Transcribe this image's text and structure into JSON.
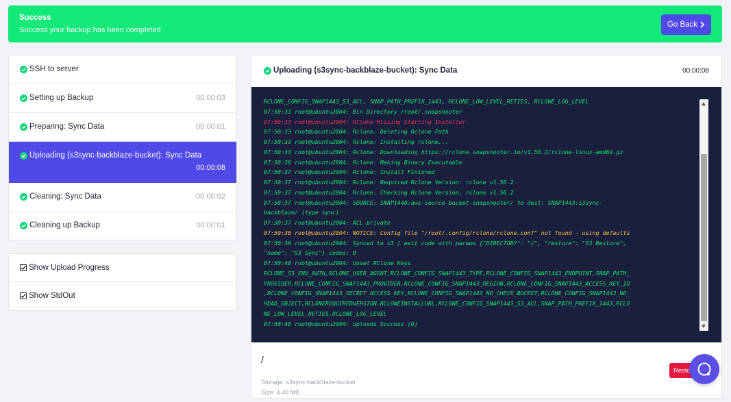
{
  "banner": {
    "title": "Success",
    "message": "Success your backup has been completed",
    "go_back_label": "Go Back"
  },
  "steps": [
    {
      "label": "SSH to server",
      "time": ""
    },
    {
      "label": "Setting up Backup",
      "time": "00:00:03"
    },
    {
      "label": "Preparing: Sync Data",
      "time": "00:00:01"
    },
    {
      "label": "Uploading (s3sync-backblaze-bucket): Sync Data",
      "time": "00:00:08",
      "active": true
    },
    {
      "label": "Cleaning: Sync Data",
      "time": "00:00:02"
    },
    {
      "label": "Cleaning up Backup",
      "time": "00:00:01"
    }
  ],
  "options": [
    {
      "label": "Show Upload Progress",
      "checked": true
    },
    {
      "label": "Show StdOut",
      "checked": true
    }
  ],
  "panel": {
    "title": "Uploading (s3sync-backblaze-bucket): Sync Data",
    "time": "00:00:08"
  },
  "log_lines": [
    {
      "text": "RCLONE_CONFIG_SNAP1443_S3_ACL, SNAP_PATH_PREFIX_1443, RCLONE_LOW_LEVEL_RETIES, RCLONE_LOG_LEVEL",
      "type": "ok"
    },
    {
      "text": "07:50:33 root@ubuntu2004: Bin Directory /root/.snapshooter",
      "type": "ok"
    },
    {
      "text": "07:50:33 root@ubuntu2004: RClone Missing Starting Installer",
      "type": "err"
    },
    {
      "text": "07:50:33 root@ubuntu2004: Rclone: Deleting Rclone Path",
      "type": "ok"
    },
    {
      "text": "07:50:33 root@ubuntu2004: Rclone: Installing rclone...",
      "type": "ok"
    },
    {
      "text": "07:50:33 root@ubuntu2004: Rclone: Downloading https://rclone.snapshooter.io/v1.56.2/rclone-linux-amd64.gz",
      "type": "ok"
    },
    {
      "text": "07:50:36 root@ubuntu2004: Rclone: Making Binary Executable",
      "type": "ok"
    },
    {
      "text": "07:50:37 root@ubuntu2004: Rclone: Install Finished",
      "type": "ok"
    },
    {
      "text": "07:50:37 root@ubuntu2004: Rclone: Required Rclone Version: rclone v1.56.2",
      "type": "ok"
    },
    {
      "text": "07:50:37 root@ubuntu2004: Rclone: Checking Rclone Version: rclone v1.56.2",
      "type": "ok"
    },
    {
      "text": "07:50:37 root@ubuntu2004: SOURCE: SNAP1440:aws-source-bucket-snapshooter/ to dest: SNAP1443:s3sync-\nbackblaze/ (type sync)",
      "type": "ok"
    },
    {
      "text": "07:50:37 root@ubuntu2004: ACL private",
      "type": "ok"
    },
    {
      "text": "07:50:38 root@ubuntu2004: NOTICE: Config file \"/root/.config/rclone/rclone.conf\" not found - using defaults",
      "type": "warn"
    },
    {
      "text": "07:50:39 root@ubuntu2004: Synced to s3 / exit code with params {\"DIRECTORY\": \"/\", \"restore\": \"S3 Restore\",\n\"name\": \"S3 Sync\"} codes: 0",
      "type": "ok"
    },
    {
      "text": "07:50:40 root@ubuntu2004: Unset RClone Keys",
      "type": "ok"
    },
    {
      "text": "RCLONE_S3_ENV_AUTH,RCLONE_USER_AGENT,RCLONE_CONFIG_SNAP1443_TYPE,RCLONE_CONFIG_SNAP1443_ENDPOINT,SNAP_PATH_\nPROVIDER,RCLONE_CONFIG_SNAP1443_PROVIDER,RCLONE_CONFIG_SNAP1443_REGION,RCLONE_CONFIG_SNAP1443_ACCESS_KEY_ID\n,RCLONE_CONFIG_SNAP1443_SECRET_ACCESS_KEY,RCLONE_CONFIG_SNAP1443_NO_CHECK_BUCKET,RCLONE_CONFIG_SNAP1443_NO_\nHEAD_OBJECT,RCLONEREQUIREDVERSION,RCLONEINSTALLURL,RCLONE_CONFIG_SNAP1443_S3_ACL,SNAP_PATH_PREFIX_1443,RCLO\nNE_LOW_LEVEL_RETIES,RCLONE_LOG_LEVEL",
      "type": "ok"
    },
    {
      "text": "07:50:40 root@ubuntu2004: Uploads Success (0)",
      "type": "ok"
    }
  ],
  "footer": {
    "path": "/",
    "storage": "Storage: s3sync-backblaze-bucket",
    "size": "Size: 4.40 MB",
    "restore_label": "Resto"
  },
  "colors": {
    "success": "#13e978",
    "primary": "#4f49e8",
    "terminal_bg": "#1a1f3d",
    "error": "#e6335b",
    "warning": "#f6c244",
    "danger": "#e5173f"
  },
  "icons": [
    "check-circle-icon",
    "chevron-right-icon",
    "checkbox-checked-icon",
    "chat-bubble-icon"
  ]
}
